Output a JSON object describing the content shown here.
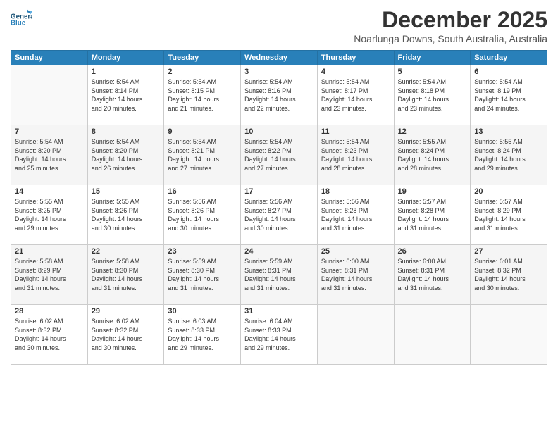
{
  "logo": {
    "line1": "General",
    "line2": "Blue"
  },
  "title": "December 2025",
  "location": "Noarlunga Downs, South Australia, Australia",
  "weekdays": [
    "Sunday",
    "Monday",
    "Tuesday",
    "Wednesday",
    "Thursday",
    "Friday",
    "Saturday"
  ],
  "weeks": [
    [
      {
        "day": "",
        "info": ""
      },
      {
        "day": "1",
        "info": "Sunrise: 5:54 AM\nSunset: 8:14 PM\nDaylight: 14 hours\nand 20 minutes."
      },
      {
        "day": "2",
        "info": "Sunrise: 5:54 AM\nSunset: 8:15 PM\nDaylight: 14 hours\nand 21 minutes."
      },
      {
        "day": "3",
        "info": "Sunrise: 5:54 AM\nSunset: 8:16 PM\nDaylight: 14 hours\nand 22 minutes."
      },
      {
        "day": "4",
        "info": "Sunrise: 5:54 AM\nSunset: 8:17 PM\nDaylight: 14 hours\nand 23 minutes."
      },
      {
        "day": "5",
        "info": "Sunrise: 5:54 AM\nSunset: 8:18 PM\nDaylight: 14 hours\nand 23 minutes."
      },
      {
        "day": "6",
        "info": "Sunrise: 5:54 AM\nSunset: 8:19 PM\nDaylight: 14 hours\nand 24 minutes."
      }
    ],
    [
      {
        "day": "7",
        "info": "Sunrise: 5:54 AM\nSunset: 8:20 PM\nDaylight: 14 hours\nand 25 minutes."
      },
      {
        "day": "8",
        "info": "Sunrise: 5:54 AM\nSunset: 8:20 PM\nDaylight: 14 hours\nand 26 minutes."
      },
      {
        "day": "9",
        "info": "Sunrise: 5:54 AM\nSunset: 8:21 PM\nDaylight: 14 hours\nand 27 minutes."
      },
      {
        "day": "10",
        "info": "Sunrise: 5:54 AM\nSunset: 8:22 PM\nDaylight: 14 hours\nand 27 minutes."
      },
      {
        "day": "11",
        "info": "Sunrise: 5:54 AM\nSunset: 8:23 PM\nDaylight: 14 hours\nand 28 minutes."
      },
      {
        "day": "12",
        "info": "Sunrise: 5:55 AM\nSunset: 8:24 PM\nDaylight: 14 hours\nand 28 minutes."
      },
      {
        "day": "13",
        "info": "Sunrise: 5:55 AM\nSunset: 8:24 PM\nDaylight: 14 hours\nand 29 minutes."
      }
    ],
    [
      {
        "day": "14",
        "info": "Sunrise: 5:55 AM\nSunset: 8:25 PM\nDaylight: 14 hours\nand 29 minutes."
      },
      {
        "day": "15",
        "info": "Sunrise: 5:55 AM\nSunset: 8:26 PM\nDaylight: 14 hours\nand 30 minutes."
      },
      {
        "day": "16",
        "info": "Sunrise: 5:56 AM\nSunset: 8:26 PM\nDaylight: 14 hours\nand 30 minutes."
      },
      {
        "day": "17",
        "info": "Sunrise: 5:56 AM\nSunset: 8:27 PM\nDaylight: 14 hours\nand 30 minutes."
      },
      {
        "day": "18",
        "info": "Sunrise: 5:56 AM\nSunset: 8:28 PM\nDaylight: 14 hours\nand 31 minutes."
      },
      {
        "day": "19",
        "info": "Sunrise: 5:57 AM\nSunset: 8:28 PM\nDaylight: 14 hours\nand 31 minutes."
      },
      {
        "day": "20",
        "info": "Sunrise: 5:57 AM\nSunset: 8:29 PM\nDaylight: 14 hours\nand 31 minutes."
      }
    ],
    [
      {
        "day": "21",
        "info": "Sunrise: 5:58 AM\nSunset: 8:29 PM\nDaylight: 14 hours\nand 31 minutes."
      },
      {
        "day": "22",
        "info": "Sunrise: 5:58 AM\nSunset: 8:30 PM\nDaylight: 14 hours\nand 31 minutes."
      },
      {
        "day": "23",
        "info": "Sunrise: 5:59 AM\nSunset: 8:30 PM\nDaylight: 14 hours\nand 31 minutes."
      },
      {
        "day": "24",
        "info": "Sunrise: 5:59 AM\nSunset: 8:31 PM\nDaylight: 14 hours\nand 31 minutes."
      },
      {
        "day": "25",
        "info": "Sunrise: 6:00 AM\nSunset: 8:31 PM\nDaylight: 14 hours\nand 31 minutes."
      },
      {
        "day": "26",
        "info": "Sunrise: 6:00 AM\nSunset: 8:31 PM\nDaylight: 14 hours\nand 31 minutes."
      },
      {
        "day": "27",
        "info": "Sunrise: 6:01 AM\nSunset: 8:32 PM\nDaylight: 14 hours\nand 30 minutes."
      }
    ],
    [
      {
        "day": "28",
        "info": "Sunrise: 6:02 AM\nSunset: 8:32 PM\nDaylight: 14 hours\nand 30 minutes."
      },
      {
        "day": "29",
        "info": "Sunrise: 6:02 AM\nSunset: 8:32 PM\nDaylight: 14 hours\nand 30 minutes."
      },
      {
        "day": "30",
        "info": "Sunrise: 6:03 AM\nSunset: 8:33 PM\nDaylight: 14 hours\nand 29 minutes."
      },
      {
        "day": "31",
        "info": "Sunrise: 6:04 AM\nSunset: 8:33 PM\nDaylight: 14 hours\nand 29 minutes."
      },
      {
        "day": "",
        "info": ""
      },
      {
        "day": "",
        "info": ""
      },
      {
        "day": "",
        "info": ""
      }
    ]
  ]
}
